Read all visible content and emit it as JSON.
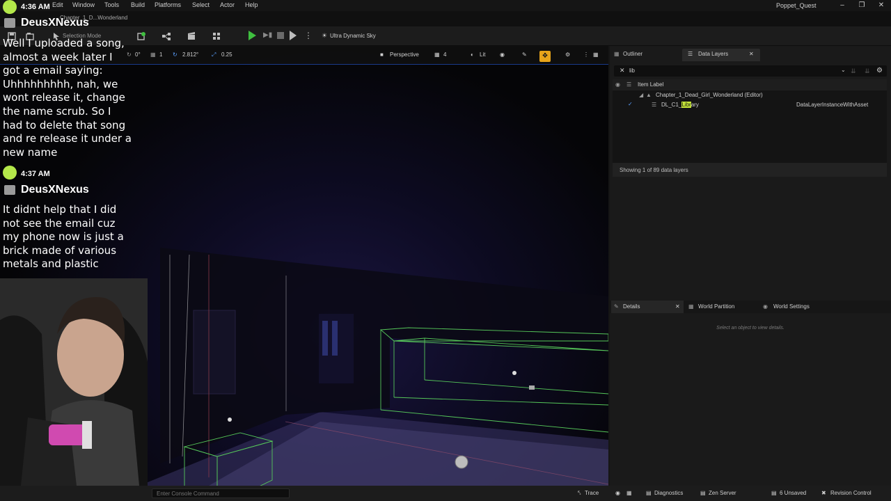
{
  "menubar": {
    "items": [
      "Edit",
      "Window",
      "Tools",
      "Build",
      "Platforms",
      "Select",
      "Actor",
      "Help"
    ],
    "project_name": "Poppet_Quest"
  },
  "level_tab": {
    "label": "Chapter_1_D...Wonderland"
  },
  "toolbar": {
    "selection_mode": "Selection Mode",
    "sky": "Ultra Dynamic Sky"
  },
  "viewport_toolbar": {
    "rotation_snap": "0°",
    "grid": "1",
    "scale": "2.812°",
    "scale_snap": "0.25",
    "perspective": "Perspective",
    "fov": "4",
    "lit": "Lit"
  },
  "right_panel": {
    "tabs": {
      "outliner": "Outliner",
      "data_layers": "Data Layers"
    },
    "search_value": "lib",
    "tree_header": "Item Label",
    "tree_rows": [
      {
        "label": "Chapter_1_Dead_Girl_Wonderland (Editor)",
        "type": ""
      },
      {
        "label_prefix": "DL_C1_",
        "label_highlight": "Libr",
        "label_suffix": "ary",
        "type": "DataLayerInstanceWithAsset"
      }
    ],
    "showing": "Showing 1 of 89 data layers",
    "details_tabs": {
      "details": "Details",
      "world_partition": "World Partition",
      "world_settings": "World Settings"
    },
    "details_empty": "Select an object to view details."
  },
  "statusbar": {
    "console_placeholder": "Enter Console Command",
    "trace": "Trace",
    "diagnostics": "Diagnostics",
    "zen_server": "Zen Server",
    "unsaved": "6 Unsaved",
    "revision_control": "Revision Control"
  },
  "chat": [
    {
      "time": "4:36 AM",
      "user": "DeusXNexus",
      "lines": [
        "Well I uploaded a song,",
        "almost a week later I",
        "got a email saying:",
        "Uhhhhhhhhh, nah, we",
        "wont release it, change",
        "the name scrub. So I",
        "had to delete that song",
        "and re release it under a",
        "new name"
      ]
    },
    {
      "time": "4:37 AM",
      "user": "DeusXNexus",
      "lines": [
        "It didnt help that I did",
        "not see the email cuz",
        "my phone now is just a",
        "brick made of various",
        "metals and plastic"
      ]
    }
  ],
  "colors": {
    "accent_green": "#3fbf3f",
    "chat_avatar": "#b4e84a",
    "camera_speed": "#e8a41a",
    "highlight": "#c8e83a"
  }
}
